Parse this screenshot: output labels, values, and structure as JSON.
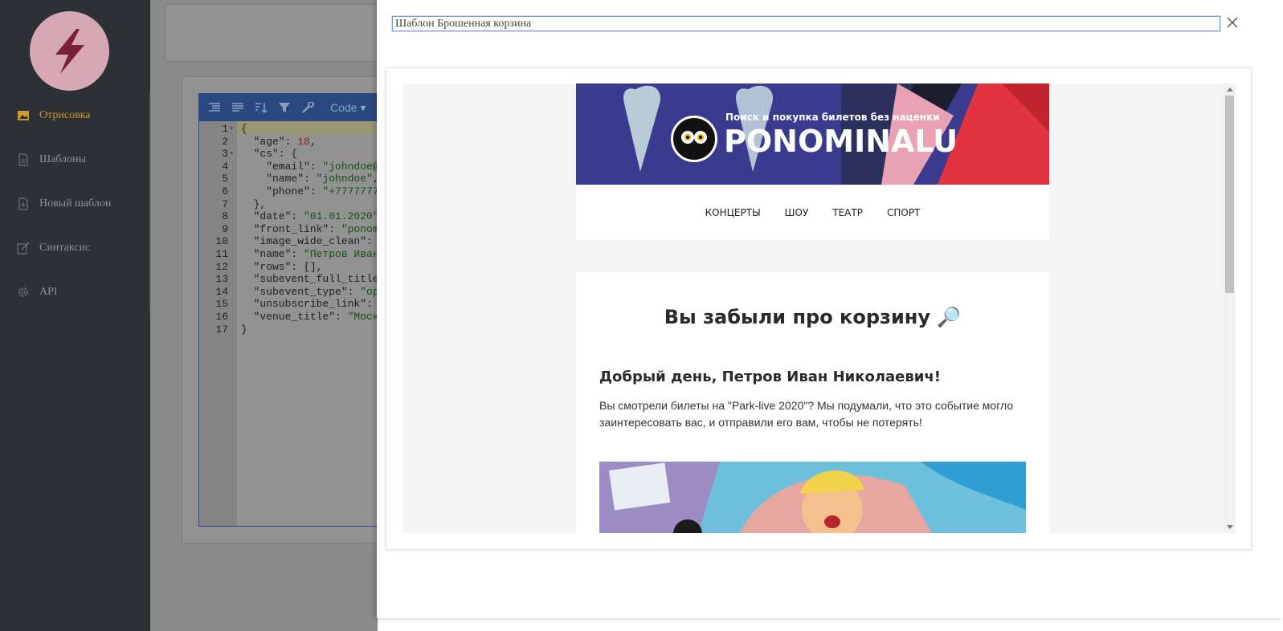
{
  "sidebar": {
    "items": [
      {
        "label": "Отрисовка",
        "icon": "image-icon",
        "active": true
      },
      {
        "label": "Шаблоны",
        "icon": "file-icon",
        "active": false
      },
      {
        "label": "Новый шаблон",
        "icon": "file-plus-icon",
        "active": false
      },
      {
        "label": "Синтаксис",
        "icon": "edit-icon",
        "active": false
      },
      {
        "label": "API",
        "icon": "gear-icon",
        "active": false
      }
    ]
  },
  "editor": {
    "mode_label": "Code ▾",
    "line_numbers": [
      "1",
      "2",
      "3",
      "4",
      "5",
      "6",
      "7",
      "8",
      "9",
      "10",
      "11",
      "12",
      "13",
      "14",
      "15",
      "16",
      "17"
    ],
    "lines": [
      "{",
      "  \"age\": 18,",
      "  \"cs\": {",
      "    \"email\": \"johndoe@",
      "    \"name\": \"johndoe\",",
      "    \"phone\": \"+7777777",
      "  },",
      "  \"date\": \"01.01.2020\"",
      "  \"front_link\": \"ponom",
      "  \"image_wide_clean\":",
      "  \"name\": \"Петров Иван",
      "  \"rows\": [],",
      "  \"subevent_full_title",
      "  \"subevent_type\": \"op",
      "  \"unsubscribe_link\":",
      "  \"venue_title\": \"Моск",
      "}"
    ]
  },
  "dialog": {
    "template_title": "Шаблон Брошенная корзина"
  },
  "email": {
    "banner_tagline": "Поиск и покупка билетов без наценки",
    "banner_brand": "PONOMINALU",
    "menu": [
      "КОНЦЕРТЫ",
      "ШОУ",
      "ТЕАТР",
      "СПОРТ"
    ],
    "heading": "Вы забыли про корзину 🔎",
    "greeting": "Добрый день, Петров Иван Николаевич!",
    "body": "Вы смотрели билеты на \"Park-live 2020\"? Мы подумали, что это событие могло заинтересовать вас, и отправили его вам, чтобы не потерять!"
  },
  "colors": {
    "sidebar_bg": "#2d3035",
    "active_nav": "#c99a2f",
    "editor_toolbar": "#2a4880",
    "overlay": "#8a8a8a"
  }
}
